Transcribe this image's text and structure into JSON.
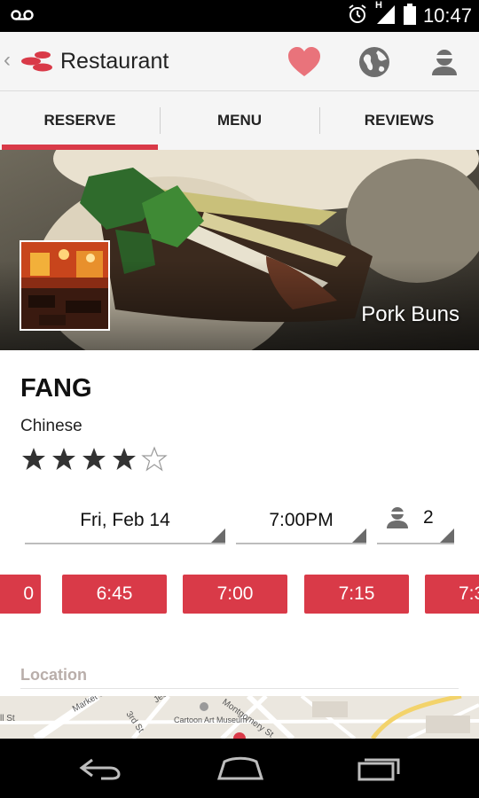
{
  "status_bar": {
    "time": "10:47",
    "network_label": "H",
    "icons": [
      "voicemail-icon",
      "alarm-icon",
      "signal-icon",
      "battery-icon"
    ]
  },
  "action_bar": {
    "title": "Restaurant",
    "icons": [
      "back-chevron-icon",
      "app-logo-icon",
      "favorite-heart-icon",
      "globe-icon",
      "profile-icon"
    ]
  },
  "tabs": [
    {
      "label": "RESERVE",
      "active": true
    },
    {
      "label": "MENU",
      "active": false
    },
    {
      "label": "REVIEWS",
      "active": false
    }
  ],
  "hero": {
    "caption": "Pork Buns"
  },
  "restaurant": {
    "name": "FANG",
    "cuisine": "Chinese",
    "rating": 4,
    "rating_max": 5
  },
  "reservation": {
    "date": "Fri, Feb 14",
    "time": "7:00PM",
    "party_size": "2"
  },
  "time_slots": [
    "0",
    "6:45",
    "7:00",
    "7:15",
    "7:3"
  ],
  "location": {
    "label": "Location",
    "map_labels": [
      "Market St",
      "3rd St",
      "Jessie St",
      "Cartoon Art Museum",
      "Montgomery St"
    ]
  },
  "colors": {
    "accent": "#d93a48",
    "heart": "#e9737b",
    "location_label": "#b9aeaa"
  }
}
